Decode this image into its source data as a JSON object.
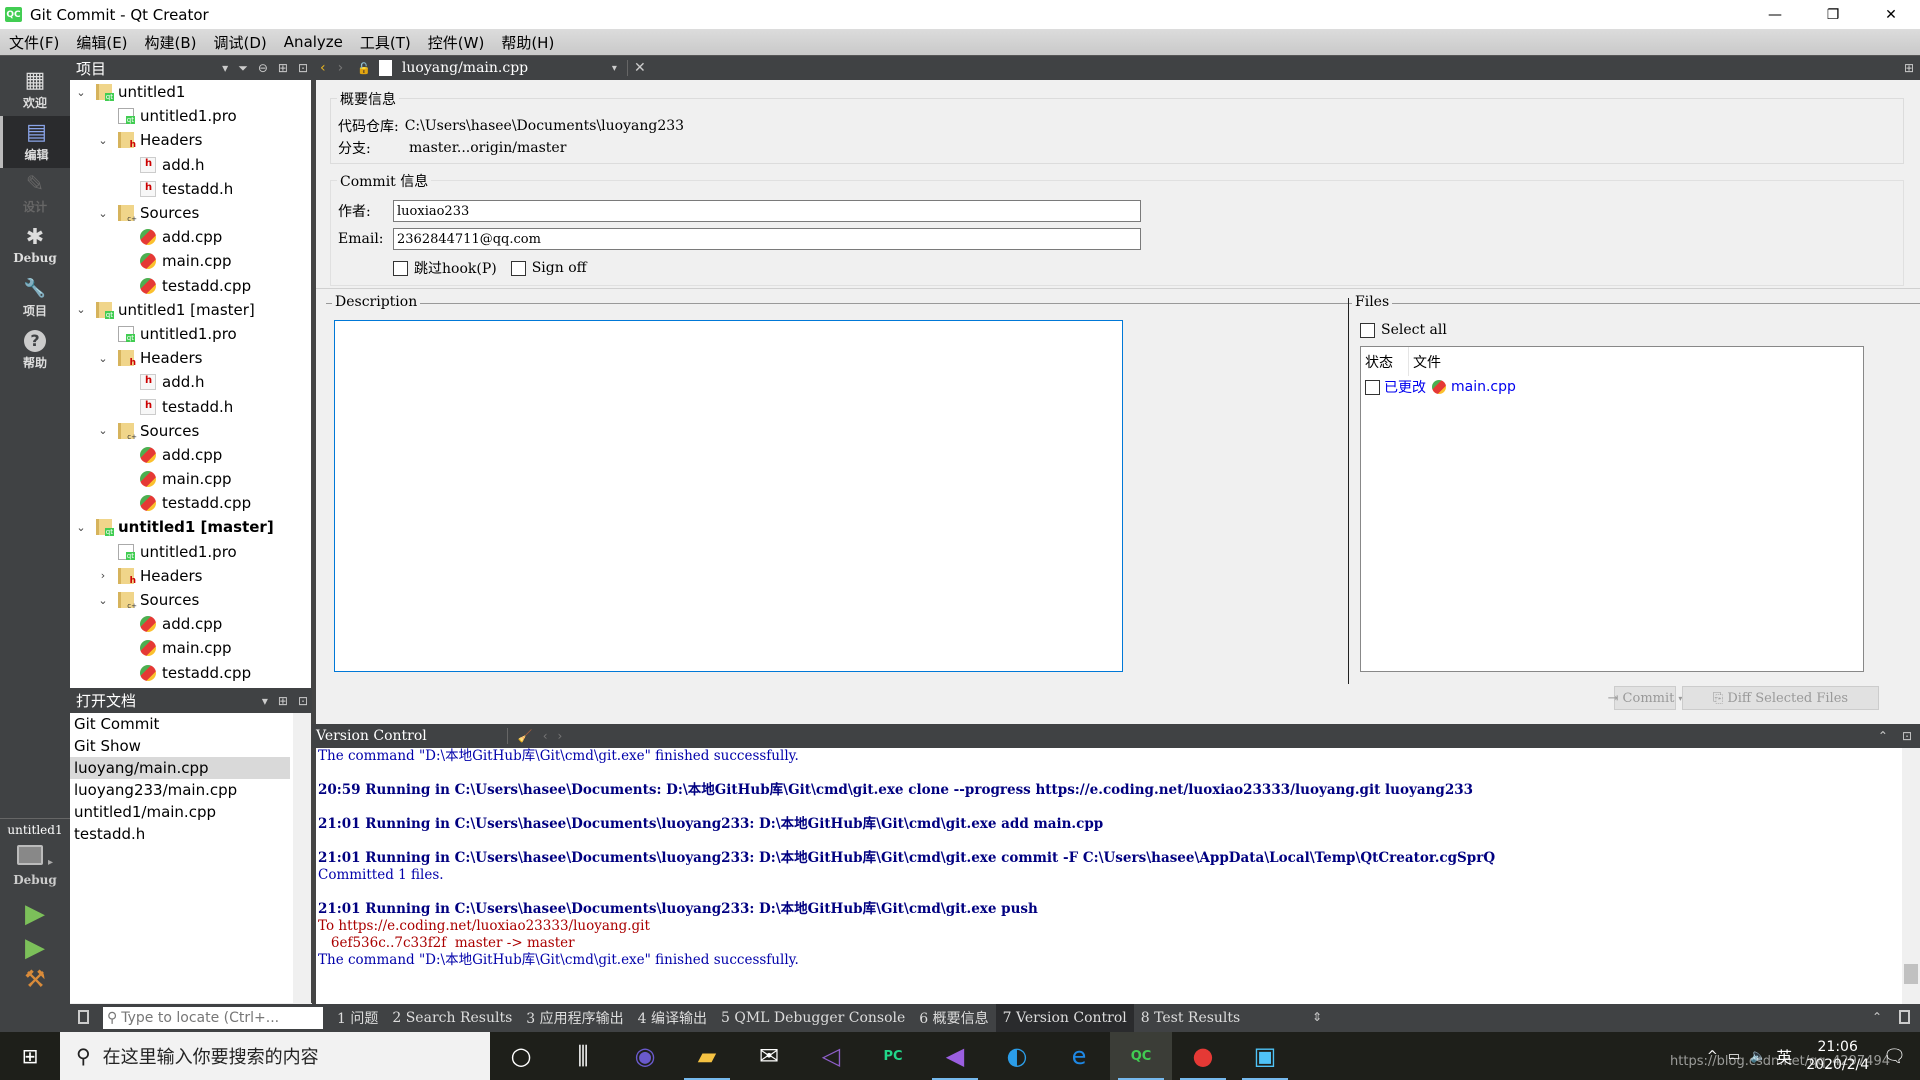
{
  "window": {
    "title": "Git Commit - Qt Creator",
    "app_icon": "QC",
    "minimize_icon": "—",
    "restore_icon": "❐",
    "close_icon": "✕"
  },
  "menu": [
    "文件(F)",
    "编辑(E)",
    "构建(B)",
    "调试(D)",
    "Analyze",
    "工具(T)",
    "控件(W)",
    "帮助(H)"
  ],
  "modes": [
    {
      "label": "欢迎",
      "icon": "grid-icon",
      "glyph": "▦"
    },
    {
      "label": "编辑",
      "icon": "edit-doc-icon",
      "glyph": "▤"
    },
    {
      "label": "设计",
      "icon": "pencil-icon",
      "glyph": "✎"
    },
    {
      "label": "Debug",
      "icon": "bug-icon",
      "glyph": "✱"
    },
    {
      "label": "项目",
      "icon": "wrench-icon",
      "glyph": "🔧"
    },
    {
      "label": "帮助",
      "icon": "help-icon",
      "glyph": "?"
    }
  ],
  "kit": {
    "project": "untitled1",
    "config": "Debug",
    "run_glyph": "▶",
    "debug_run_glyph": "▶",
    "build_glyph": "⚒"
  },
  "project_pane": {
    "title": "项目",
    "tree": [
      {
        "label": "untitled1",
        "level": 0,
        "type": "proj",
        "arrow": "⌄"
      },
      {
        "label": "untitled1.pro",
        "level": 1,
        "type": "pro",
        "arrow": ""
      },
      {
        "label": "Headers",
        "level": 1,
        "type": "hfolder",
        "arrow": "⌄"
      },
      {
        "label": "add.h",
        "level": 2,
        "type": "hfile",
        "arrow": ""
      },
      {
        "label": "testadd.h",
        "level": 2,
        "type": "hfile",
        "arrow": ""
      },
      {
        "label": "Sources",
        "level": 1,
        "type": "sfolder",
        "arrow": "⌄"
      },
      {
        "label": "add.cpp",
        "level": 2,
        "type": "cpp",
        "arrow": ""
      },
      {
        "label": "main.cpp",
        "level": 2,
        "type": "cpp",
        "arrow": ""
      },
      {
        "label": "testadd.cpp",
        "level": 2,
        "type": "cpp",
        "arrow": ""
      },
      {
        "label": "untitled1 [master]",
        "level": 0,
        "type": "proj",
        "arrow": "⌄"
      },
      {
        "label": "untitled1.pro",
        "level": 1,
        "type": "pro",
        "arrow": ""
      },
      {
        "label": "Headers",
        "level": 1,
        "type": "hfolder",
        "arrow": "⌄"
      },
      {
        "label": "add.h",
        "level": 2,
        "type": "hfile",
        "arrow": ""
      },
      {
        "label": "testadd.h",
        "level": 2,
        "type": "hfile",
        "arrow": ""
      },
      {
        "label": "Sources",
        "level": 1,
        "type": "sfolder",
        "arrow": "⌄"
      },
      {
        "label": "add.cpp",
        "level": 2,
        "type": "cpp",
        "arrow": ""
      },
      {
        "label": "main.cpp",
        "level": 2,
        "type": "cpp",
        "arrow": ""
      },
      {
        "label": "testadd.cpp",
        "level": 2,
        "type": "cpp",
        "arrow": ""
      },
      {
        "label": "untitled1 [master]",
        "level": 0,
        "type": "proj",
        "arrow": "⌄",
        "bold": true
      },
      {
        "label": "untitled1.pro",
        "level": 1,
        "type": "pro",
        "arrow": ""
      },
      {
        "label": "Headers",
        "level": 1,
        "type": "hfolder",
        "arrow": "›"
      },
      {
        "label": "Sources",
        "level": 1,
        "type": "sfolder",
        "arrow": "⌄"
      },
      {
        "label": "add.cpp",
        "level": 2,
        "type": "cpp",
        "arrow": ""
      },
      {
        "label": "main.cpp",
        "level": 2,
        "type": "cpp",
        "arrow": ""
      },
      {
        "label": "testadd.cpp",
        "level": 2,
        "type": "cpp",
        "arrow": ""
      }
    ]
  },
  "open_docs": {
    "title": "打开文档",
    "items": [
      {
        "label": "Git Commit",
        "selected": false
      },
      {
        "label": "Git Show",
        "selected": false
      },
      {
        "label": "luoyang/main.cpp",
        "selected": true
      },
      {
        "label": "luoyang233/main.cpp",
        "selected": false
      },
      {
        "label": "untitled1/main.cpp",
        "selected": false
      },
      {
        "label": "testadd.h",
        "selected": false
      }
    ]
  },
  "editor_toolbar": {
    "current_file": "luoyang/main.cpp",
    "back_glyph": "‹",
    "forward_glyph": "›",
    "lock_glyph": "🔓",
    "dropdown_glyph": "▾",
    "close_glyph": "✕",
    "split_glyph": "⊞"
  },
  "summary": {
    "legend": "概要信息",
    "repo_label": "代码仓库:",
    "repo_value": "C:\\Users\\hasee\\Documents\\luoyang233",
    "branch_label": "分支:",
    "branch_value": "master...origin/master"
  },
  "commit_info": {
    "legend": "Commit 信息",
    "author_label": "作者:",
    "author_value": "luoxiao233",
    "email_label": "Email:",
    "email_value": "2362844711@qq.com",
    "skip_hooks_label": "跳过hook(P)",
    "skip_hooks_checked": false,
    "sign_off_label": "Sign off",
    "sign_off_checked": false
  },
  "description": {
    "legend": "Description",
    "value": ""
  },
  "files": {
    "legend": "Files",
    "select_all_label": "Select all",
    "select_all_checked": false,
    "columns": [
      "状态",
      "文件"
    ],
    "rows": [
      {
        "checked": false,
        "status": "已更改",
        "file": "main.cpp"
      }
    ],
    "link_color": "#0000ee"
  },
  "buttons": {
    "commit": "Commit",
    "diff": "Diff Selected Files"
  },
  "output_pane": {
    "title": "Version Control",
    "lines": [
      {
        "text": "The command \"D:\\本地GitHub库\\Git\\cmd\\git.exe\" finished successfully.",
        "style": "blue"
      },
      {
        "text": "",
        "style": "blue"
      },
      {
        "text": "20:59 Running in C:\\Users\\hasee\\Documents: D:\\本地GitHub库\\Git\\cmd\\git.exe clone --progress https://e.coding.net/luoxiao23333/luoyang.git luoyang233",
        "style": "bold"
      },
      {
        "text": "",
        "style": "blue"
      },
      {
        "text": "21:01 Running in C:\\Users\\hasee\\Documents\\luoyang233: D:\\本地GitHub库\\Git\\cmd\\git.exe add main.cpp",
        "style": "bold"
      },
      {
        "text": "",
        "style": "blue"
      },
      {
        "text": "21:01 Running in C:\\Users\\hasee\\Documents\\luoyang233: D:\\本地GitHub库\\Git\\cmd\\git.exe commit -F C:\\Users\\hasee\\AppData\\Local\\Temp\\QtCreator.cgSprQ",
        "style": "bold"
      },
      {
        "text": "Committed 1 files.",
        "style": "blue"
      },
      {
        "text": "",
        "style": "blue"
      },
      {
        "text": "21:01 Running in C:\\Users\\hasee\\Documents\\luoyang233: D:\\本地GitHub库\\Git\\cmd\\git.exe push",
        "style": "bold"
      },
      {
        "text": "To https://e.coding.net/luoxiao23333/luoyang.git",
        "style": "red"
      },
      {
        "text": "   6ef536c..7c33f2f  master -> master",
        "style": "red"
      },
      {
        "text": "The command \"D:\\本地GitHub库\\Git\\cmd\\git.exe\" finished successfully.",
        "style": "blue"
      }
    ]
  },
  "statusbar": {
    "locator_placeholder": "Type to locate (Ctrl+...",
    "panes": [
      {
        "label": "1 问题",
        "active": false
      },
      {
        "label": "2 Search Results",
        "active": false
      },
      {
        "label": "3 应用程序输出",
        "active": false
      },
      {
        "label": "4 编译输出",
        "active": false
      },
      {
        "label": "5 QML Debugger Console",
        "active": false
      },
      {
        "label": "6 概要信息",
        "active": false
      },
      {
        "label": "7 Version Control",
        "active": true
      },
      {
        "label": "8 Test Results",
        "active": false
      }
    ]
  },
  "taskbar": {
    "search_placeholder": "在这里输入你要搜索的内容",
    "apps": [
      {
        "name": "cortana",
        "glyph": "○",
        "color": "#ffffff",
        "running": false,
        "active": false
      },
      {
        "name": "task-view",
        "glyph": "⫼",
        "color": "#ffffff",
        "running": false,
        "active": false
      },
      {
        "name": "eclipse",
        "glyph": "◉",
        "color": "#6a5acd",
        "running": false,
        "active": false
      },
      {
        "name": "file-explorer",
        "glyph": "▰",
        "color": "#f5c242",
        "running": true,
        "active": false
      },
      {
        "name": "mail",
        "glyph": "✉",
        "color": "#ffffff",
        "running": false,
        "active": false
      },
      {
        "name": "visual-studio-blend",
        "glyph": "◁",
        "color": "#8e5fc9",
        "running": false,
        "active": false
      },
      {
        "name": "pycharm",
        "glyph": "PC",
        "color": "#21d789",
        "running": false,
        "active": false
      },
      {
        "name": "visual-studio",
        "glyph": "◀",
        "color": "#9b5fe0",
        "running": true,
        "active": false
      },
      {
        "name": "eclipse-installer",
        "glyph": "◐",
        "color": "#2b9de8",
        "running": false,
        "active": false
      },
      {
        "name": "edge",
        "glyph": "e",
        "color": "#1e88e5",
        "running": false,
        "active": false
      },
      {
        "name": "qt-creator",
        "glyph": "QC",
        "color": "#41cd52",
        "running": true,
        "active": true
      },
      {
        "name": "chrome",
        "glyph": "●",
        "color": "#e53935",
        "running": true,
        "active": false
      },
      {
        "name": "control-panel",
        "glyph": "▣",
        "color": "#4fc3f7",
        "running": true,
        "active": false
      }
    ],
    "ime": "英",
    "time": "21:06",
    "date": "2020/2/4",
    "watermark": "https://blog.csdn.net/qq_4297494"
  }
}
